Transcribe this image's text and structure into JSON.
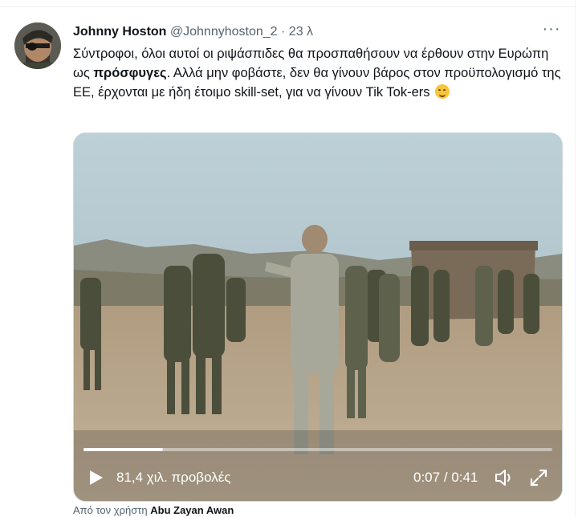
{
  "tweet": {
    "author_name": "Johnny Hoston",
    "author_handle": "@Johnnyhoston_2",
    "separator": "·",
    "time": "23 λ",
    "more_label": "···",
    "text_part1": "Σύντροφοι, όλοι αυτοί οι ριψάσπιδες θα προσπαθήσουν να έρθουν στην Ευρώπη ως ",
    "text_bold": "πρόσφυγες",
    "text_part2": ". Αλλά μην φοβάστε, δεν θα γίνουν βάρος στον προϋπολογισμό της ΕΕ, έρχονται με ήδη έτοιμο skill-set, για να γίνουν Tik Tok-ers",
    "emoji_icon": "relieved-face-emoji"
  },
  "video": {
    "views_label": "81,4 χιλ. προβολές",
    "time_current": "0:07",
    "time_separator": "/",
    "time_total": "0:41",
    "progress_fraction": 0.17
  },
  "attribution": {
    "prefix": "Από τον χρήστη",
    "user": "Abu Zayan Awan"
  },
  "colors": {
    "text": "#0f1419",
    "secondary": "#536471",
    "border": "#cfd9de"
  }
}
